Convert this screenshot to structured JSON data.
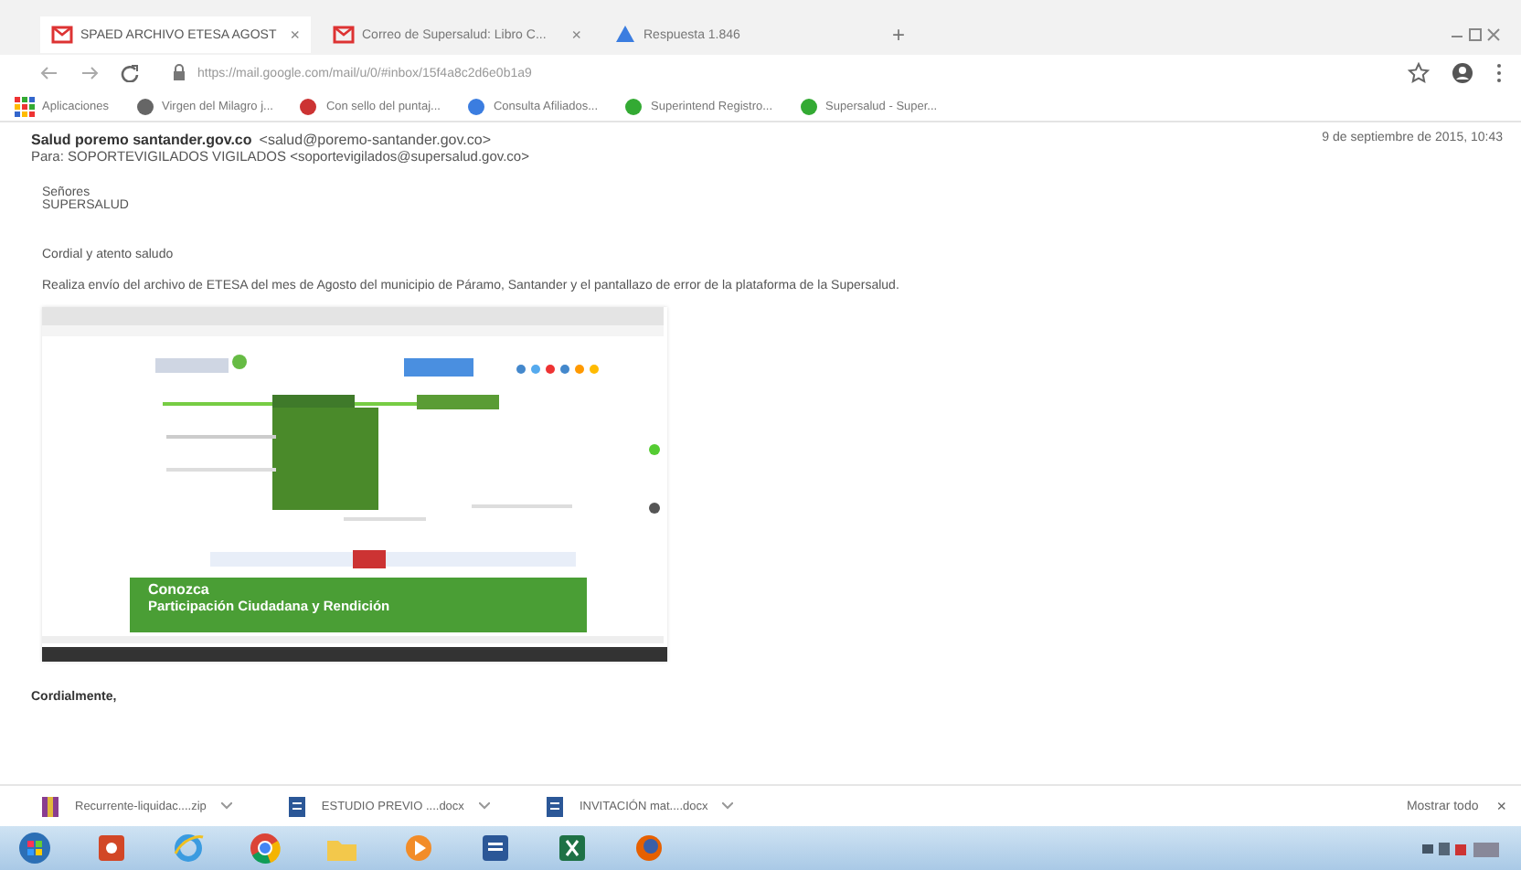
{
  "tabs": [
    {
      "label": "SPAED ARCHIVO ETESA AGOST",
      "selected": true,
      "close": "×"
    },
    {
      "label": "Correo de Supersalud: Libro C...",
      "selected": false,
      "close": "×"
    },
    {
      "label": "Respuesta 1.846",
      "selected": false
    }
  ],
  "new_tab": "+",
  "address_bar": {
    "url": "https://mail.google.com/mail/u/0/#inbox/15f4a8c2d6e0b1a9"
  },
  "bookmarks": [
    "Aplicaciones",
    "Virgen del Milagro j...",
    "Con sello del puntaj...",
    "Consulta Afiliados...",
    "Superintend Registro...",
    "Supersalud - Super..."
  ],
  "email": {
    "from": "Salud poremo santander.gov.co",
    "from_address": "<salud@poremo-santander.gov.co>",
    "to": "Para: SOPORTEVIGILADOS VIGILADOS <soportevigilados@supersalud.gov.co>",
    "date": "9 de septiembre de 2015, 10:43",
    "body": [
      "Señores",
      "SUPERSALUD",
      "Cordial y atento saludo",
      "Realiza envío del archivo de ETESA del mes de Agosto del municipio de Páramo, Santander y el pantallazo de error de la plataforma de la Supersalud."
    ],
    "attachment": {
      "banner_title": "Conozca",
      "banner_text": "Participación Ciudadana y Rendición"
    },
    "signoff": "Cordialmente,"
  },
  "downloads": [
    {
      "name": "Recurrente-liquidac....zip",
      "kind": "zip"
    },
    {
      "name": "ESTUDIO PREVIO ....docx",
      "kind": "doc"
    },
    {
      "name": "INVITACIÓN mat....docx",
      "kind": "doc"
    }
  ],
  "show_all": "Mostrar todo",
  "downloads_close": "×"
}
